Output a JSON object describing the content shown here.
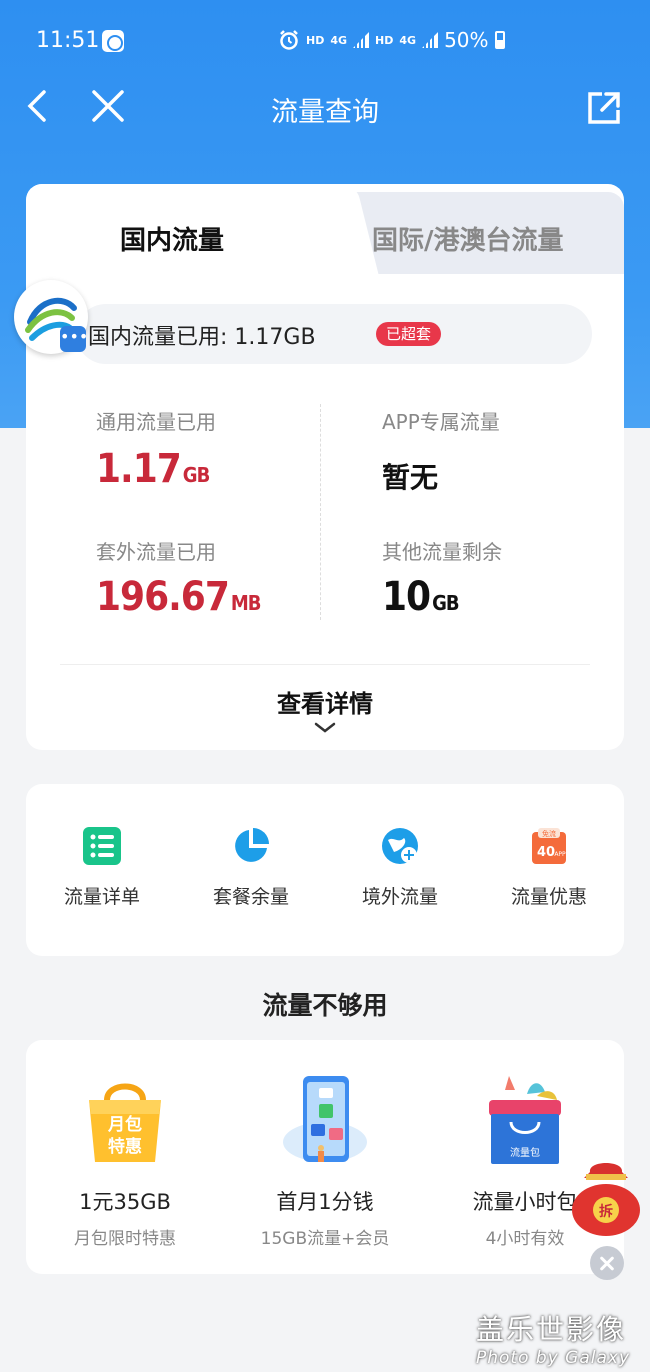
{
  "status_bar": {
    "time": "11:51",
    "hd1": "HD",
    "net1": "4G",
    "hd2": "HD",
    "net2": "4G",
    "battery": "50%"
  },
  "nav": {
    "title": "流量查询"
  },
  "tabs": {
    "domestic": "国内流量",
    "international": "国际/港澳台流量"
  },
  "summary": {
    "text": "国内流量已用: 1.17GB",
    "badge": "已超套"
  },
  "stats": {
    "general_label": "通用流量已用",
    "general_value": "1.17",
    "general_unit": "GB",
    "app_label": "APP专属流量",
    "app_value": "暂无",
    "extra_label": "套外流量已用",
    "extra_value": "196.67",
    "extra_unit": "MB",
    "other_label": "其他流量剩余",
    "other_value": "10",
    "other_unit": "GB"
  },
  "detail_button": "查看详情",
  "shortcuts": [
    {
      "label": "流量详单",
      "icon": "list-icon"
    },
    {
      "label": "套餐余量",
      "icon": "pie-chart-icon"
    },
    {
      "label": "境外流量",
      "icon": "globe-plane-icon"
    },
    {
      "label": "流量优惠",
      "icon": "discount-tag-icon"
    }
  ],
  "section_title": "流量不够用",
  "offers": [
    {
      "name": "1元35GB",
      "desc": "月包限时特惠",
      "bag_line1": "月包",
      "bag_line2": "特惠"
    },
    {
      "name": "首月1分钱",
      "desc": "15GB流量+会员"
    },
    {
      "name": "流量小时包",
      "desc": "4小时有效",
      "box_label": "流量包"
    }
  ],
  "discount_icon_text": {
    "top": "免流",
    "main": "40",
    "sub": "APP"
  },
  "float": {
    "redpacket_label": "拆"
  },
  "watermark": {
    "line1": "盖乐世影像",
    "line2": "Photo by Galaxy"
  },
  "colors": {
    "primary_blue": "#2e8ff1",
    "value_red": "#c8293a",
    "badge_red": "#e8374a",
    "icon_green": "#19c48a",
    "icon_blue": "#1d9ee8",
    "icon_orange": "#f46b3b"
  }
}
